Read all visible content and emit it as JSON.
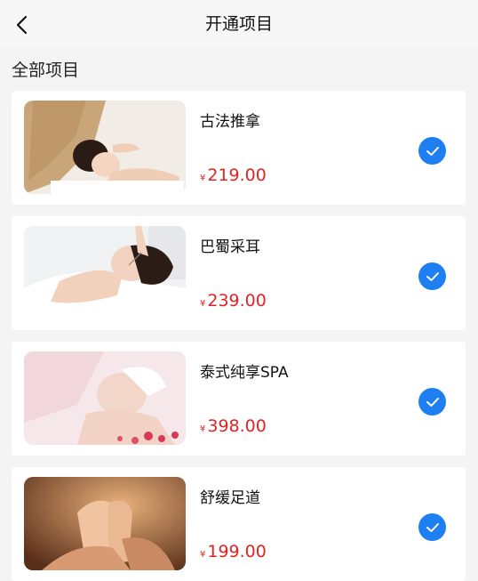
{
  "header": {
    "title": "开通项目"
  },
  "section": {
    "title": "全部项目"
  },
  "colors": {
    "accent": "#1e7ff2",
    "price": "#e02424"
  },
  "items": [
    {
      "name": "古法推拿",
      "currency": "¥",
      "price": "219.00",
      "selected": true
    },
    {
      "name": "巴蜀采耳",
      "currency": "¥",
      "price": "239.00",
      "selected": true
    },
    {
      "name": "泰式纯享SPA",
      "currency": "¥",
      "price": "398.00",
      "selected": true
    },
    {
      "name": "舒缓足道",
      "currency": "¥",
      "price": "199.00",
      "selected": true
    }
  ]
}
